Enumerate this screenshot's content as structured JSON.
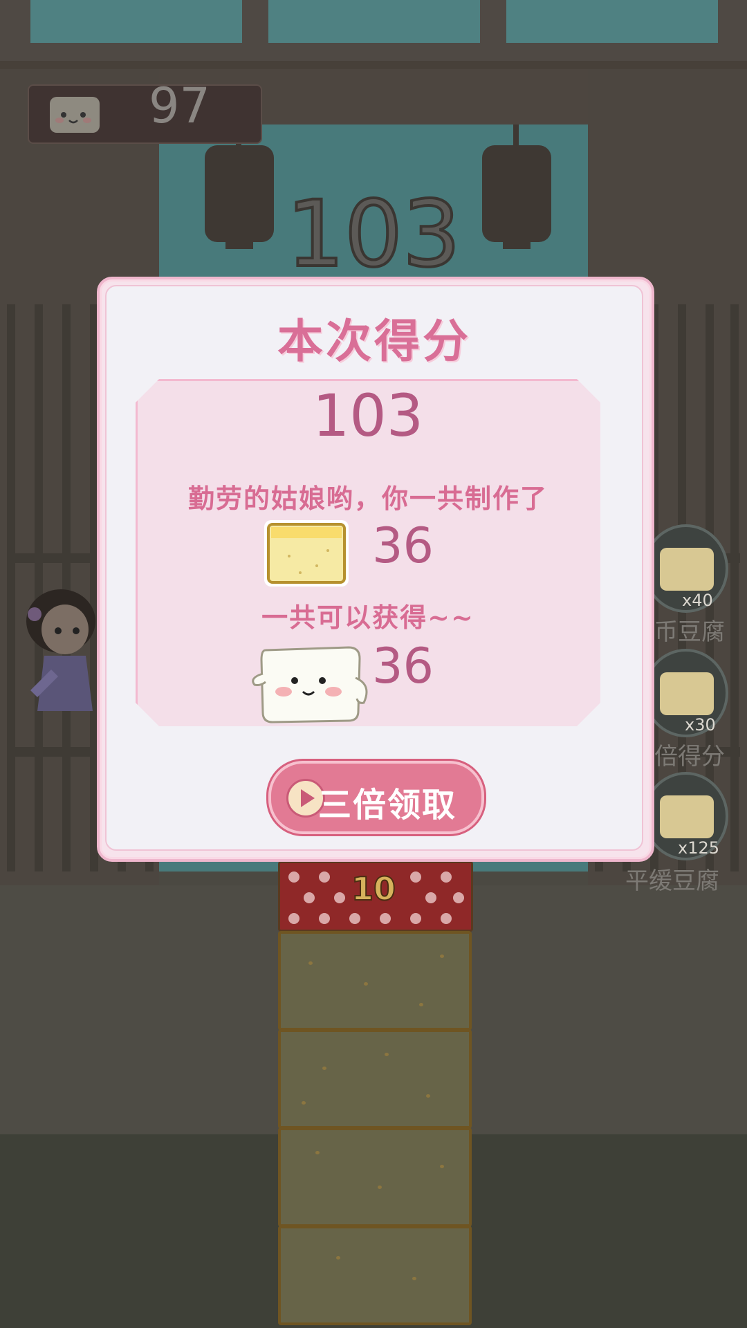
{
  "hud": {
    "coins": "97",
    "current_score": "103"
  },
  "result_dialog": {
    "title": "本次得分",
    "score": "103",
    "made_message": "勤劳的姑娘哟，你一共制作了",
    "made_count": "36",
    "earn_message": "一共可以获得~~",
    "earn_count": "36",
    "triple_button_label": "三倍领取"
  },
  "stack": {
    "top_block_number": "10"
  },
  "powerups": [
    {
      "icon": "coin-tofu-icon",
      "count": "x40",
      "label": "币豆腐"
    },
    {
      "icon": "double-score-tofu-icon",
      "count": "x30",
      "label": "倍得分"
    },
    {
      "icon": "slow-tofu-icon",
      "count": "x125",
      "label": "平缓豆腐"
    }
  ],
  "colors": {
    "accent_pink": "#d96f97",
    "score_text": "#b45a83",
    "button": "#e27a94"
  }
}
